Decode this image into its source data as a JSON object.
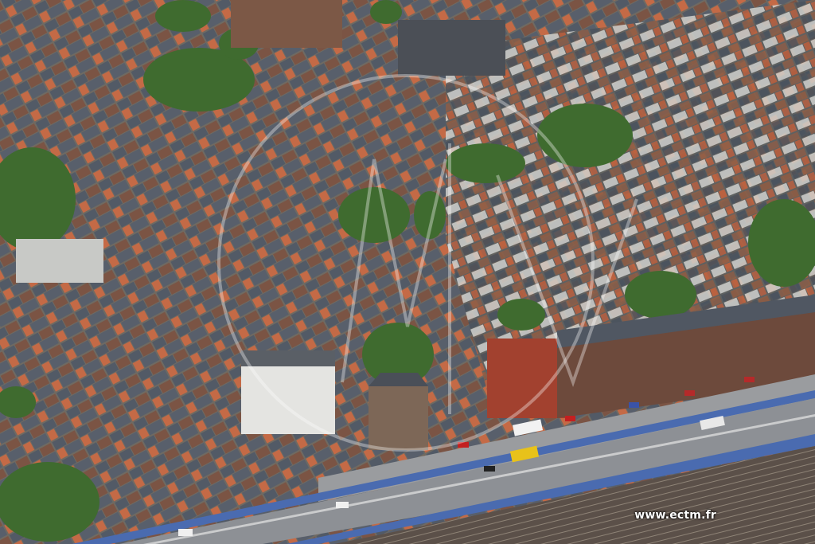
{
  "photo": {
    "subject": "aerial-city",
    "watermark": "www.ectm.fr",
    "colors": {
      "roof_slate": "#4e5560",
      "roof_tile": "#c96b45",
      "brick": "#8a5a44",
      "foliage": "#3f6b2f",
      "road": "#8d9095",
      "rail_bed": "#5b5049",
      "barrier_blue": "#4a6bb0"
    }
  }
}
